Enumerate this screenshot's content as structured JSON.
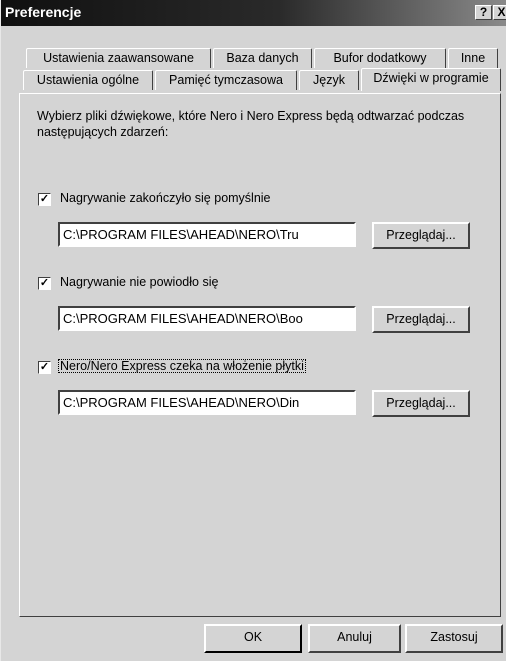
{
  "window": {
    "title": "Preferencje",
    "help_label": "?",
    "close_label": "X"
  },
  "tabs_row1": [
    {
      "label": "Ustawienia zaawansowane"
    },
    {
      "label": "Baza danych"
    },
    {
      "label": "Bufor dodatkowy"
    },
    {
      "label": "Inne"
    }
  ],
  "tabs_row2": [
    {
      "label": "Ustawienia ogólne"
    },
    {
      "label": "Pamięć tymczasowa"
    },
    {
      "label": "Język"
    },
    {
      "label": "Dźwięki w programie",
      "active": true
    }
  ],
  "description": "Wybierz pliki dźwiękowe, które Nero i Nero Express będą odtwarzać podczas następujących zdarzeń:",
  "events": [
    {
      "checked": true,
      "label": "Nagrywanie zakończyło się pomyślnie",
      "path": "C:\\PROGRAM FILES\\AHEAD\\NERO\\Tru",
      "browse_label": "Przeglądaj..."
    },
    {
      "checked": true,
      "label": "Nagrywanie nie powiodło się",
      "path": "C:\\PROGRAM FILES\\AHEAD\\NERO\\Boo",
      "browse_label": "Przeglądaj..."
    },
    {
      "checked": true,
      "label": "Nero/Nero Express czeka na włożenie płytki",
      "path": "C:\\PROGRAM FILES\\AHEAD\\NERO\\Din",
      "browse_label": "Przeglądaj..."
    }
  ],
  "footer": {
    "ok_label": "OK",
    "cancel_label": "Anuluj",
    "apply_label": "Zastosuj"
  }
}
